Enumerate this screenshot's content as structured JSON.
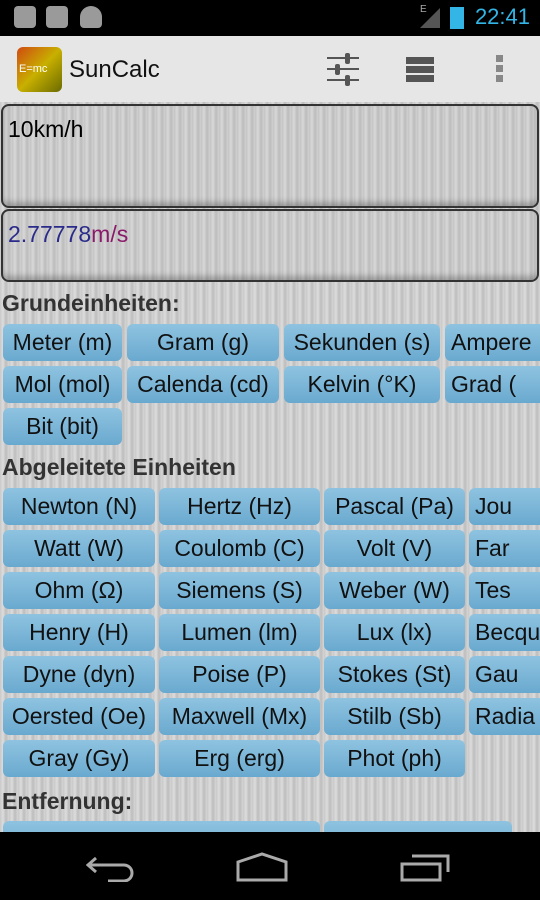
{
  "status_bar": {
    "time": "22:41",
    "network": "E"
  },
  "app": {
    "title": "SunCalc",
    "logo_text": "E=mc"
  },
  "input": {
    "value": "10km/h"
  },
  "result": {
    "number": "2.77778",
    "unit_m": "m",
    "unit_rest": "/s",
    "colors": {
      "number": "#2a2a8a",
      "unit": "#8a1a6a"
    }
  },
  "sections": [
    {
      "title": "Grundeinheiten:",
      "buttons": [
        "Meter (m)",
        "Gram (g)",
        "Sekunden (s)",
        "Ampere",
        "Mol (mol)",
        "Calenda (cd)",
        "Kelvin (°K)",
        "Grad (",
        "Bit (bit)"
      ]
    },
    {
      "title": "Abgeleitete Einheiten",
      "buttons": [
        "Newton (N)",
        "Hertz (Hz)",
        "Pascal (Pa)",
        "Jou",
        "Watt (W)",
        "Coulomb (C)",
        "Volt (V)",
        "Far",
        "Ohm (Ω)",
        "Siemens (S)",
        "Weber (W)",
        "Tes",
        "Henry (H)",
        "Lumen (lm)",
        "Lux (lx)",
        "Becqu",
        "Dyne (dyn)",
        "Poise (P)",
        "Stokes (St)",
        "Gau",
        "Oersted (Oe)",
        "Maxwell (Mx)",
        "Stilb (Sb)",
        "Radia",
        "Gray (Gy)",
        "Erg (erg)",
        "Phot (ph)"
      ]
    },
    {
      "title": "Entfernung:"
    }
  ]
}
